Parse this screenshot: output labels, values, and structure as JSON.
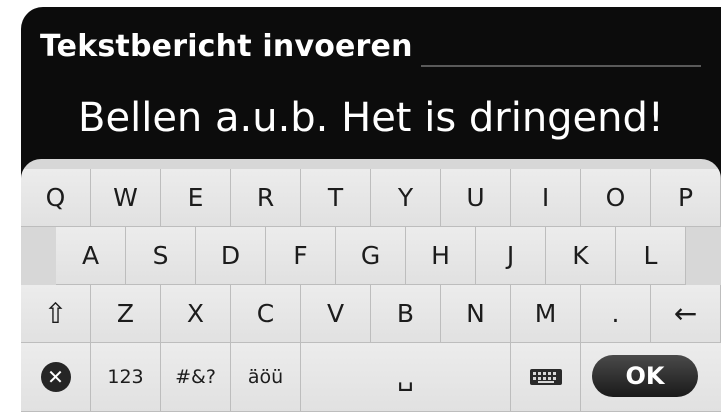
{
  "header": {
    "title": "Tekstbericht invoeren"
  },
  "input": {
    "value": "Bellen a.u.b. Het is dringend!"
  },
  "keyboard": {
    "row1": [
      "Q",
      "W",
      "E",
      "R",
      "T",
      "Y",
      "U",
      "I",
      "O",
      "P"
    ],
    "row2": [
      "A",
      "S",
      "D",
      "F",
      "G",
      "H",
      "J",
      "K",
      "L"
    ],
    "row3": [
      "Z",
      "X",
      "C",
      "V",
      "B",
      "N",
      "M",
      "."
    ],
    "shift_icon": "⇧",
    "backspace_icon": "←",
    "cancel_icon": "✕",
    "numbers_label": "123",
    "symbols_label": "#&?",
    "accents_label": "äöü",
    "space_icon": "␣",
    "keyboard_icon": "keyboard-icon",
    "ok_label": "OK"
  }
}
